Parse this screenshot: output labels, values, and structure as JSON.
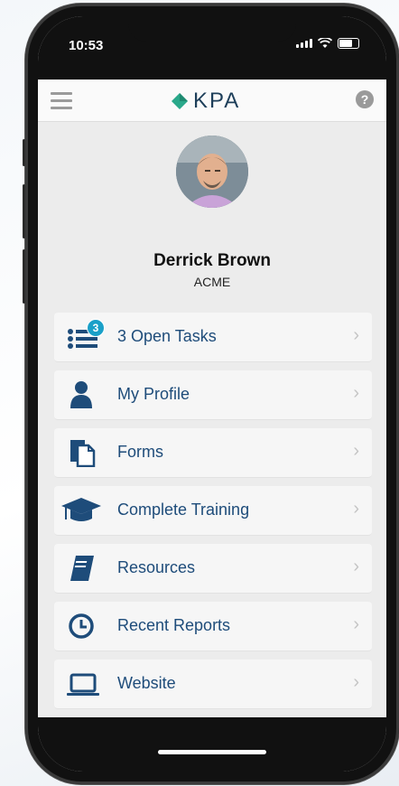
{
  "status": {
    "time": "10:53"
  },
  "header": {
    "logo_text": "KPA"
  },
  "profile": {
    "name": "Derrick Brown",
    "company": "ACME"
  },
  "menu": {
    "items": [
      {
        "label": "3 Open Tasks",
        "icon": "task-list-icon",
        "badge": "3"
      },
      {
        "label": "My Profile",
        "icon": "person-icon"
      },
      {
        "label": "Forms",
        "icon": "forms-icon"
      },
      {
        "label": "Complete Training",
        "icon": "graduation-cap-icon"
      },
      {
        "label": "Resources",
        "icon": "book-icon"
      },
      {
        "label": "Recent Reports",
        "icon": "clock-icon"
      },
      {
        "label": "Website",
        "icon": "laptop-icon"
      }
    ]
  },
  "colors": {
    "accent": "#1e4c7a",
    "logo_green": "#2aa88a",
    "badge": "#1aa0c8"
  }
}
